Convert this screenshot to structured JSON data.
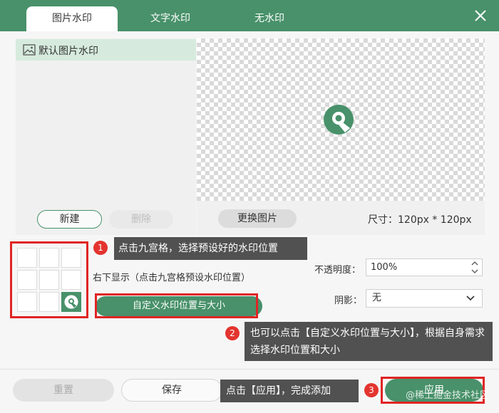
{
  "tabs": [
    {
      "label": "图片水印",
      "active": true
    },
    {
      "label": "文字水印",
      "active": false
    },
    {
      "label": "无水印",
      "active": false
    }
  ],
  "list": {
    "items": [
      {
        "label": "默认图片水印",
        "icon": "image-icon"
      }
    ],
    "new_label": "新建",
    "delete_label": "删除"
  },
  "preview": {
    "change_label": "更换图片",
    "size_text": "尺寸：120px * 120px"
  },
  "position": {
    "grid_selected": "bottom-right",
    "hint": "右下显示（点击九宫格预设水印位置）",
    "custom_label": "自定义水印位置与大小"
  },
  "opacity": {
    "label": "不透明度：",
    "value": "100%"
  },
  "shadow": {
    "label": "阴影：",
    "value": "无"
  },
  "footer": {
    "reset_label": "重置",
    "save_label": "保存",
    "apply_label": "应用"
  },
  "annotations": {
    "n1": "1",
    "n2": "2",
    "n3": "3",
    "c1": "点击九宫格，选择预设好的水印位置",
    "c2": "也可以点击【自定义水印位置与大小】，根据自身需求选择水印位置和大小",
    "c3": "点击【应用】，完成添加"
  },
  "watermark_text": "@稀土掘金技术社区",
  "colors": {
    "accent": "#48916a",
    "annotation_red": "#e02424",
    "callout_bg": "#515151"
  }
}
